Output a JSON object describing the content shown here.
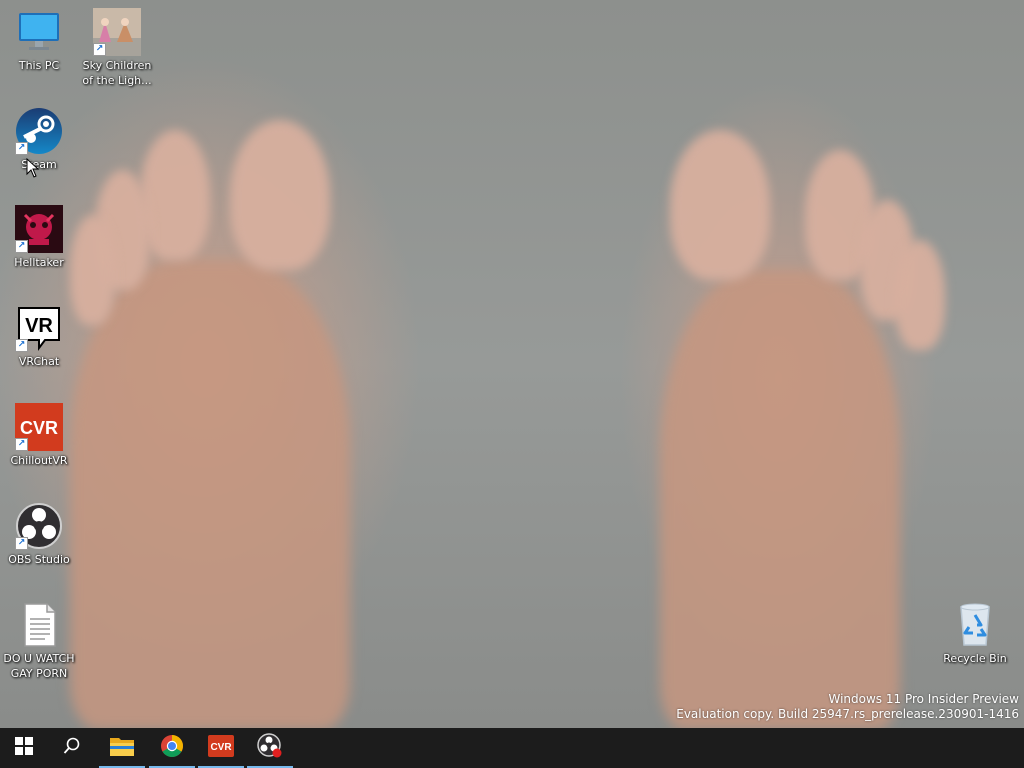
{
  "desktop": {
    "icons": [
      {
        "name": "This PC",
        "icon": "monitor-icon",
        "shortcut": false
      },
      {
        "name": "Sky Children\nof the Ligh...",
        "icon": "sky-game-icon",
        "shortcut": true
      },
      {
        "name": "Steam",
        "icon": "steam-icon",
        "shortcut": true
      },
      {
        "name": "Helltaker",
        "icon": "helltaker-icon",
        "shortcut": true
      },
      {
        "name": "VRChat",
        "icon": "vrchat-icon",
        "shortcut": true
      },
      {
        "name": "ChilloutVR",
        "icon": "chilloutvr-icon",
        "shortcut": true
      },
      {
        "name": "OBS Studio",
        "icon": "obs-icon",
        "shortcut": true
      },
      {
        "name": "DO U WATCH\nGAY PORN",
        "icon": "text-file-icon",
        "shortcut": false
      },
      {
        "name": "Recycle Bin",
        "icon": "recycle-bin-icon",
        "shortcut": false
      }
    ],
    "watermark": {
      "line1": "Windows 11 Pro Insider Preview",
      "line2": "Evaluation copy. Build 25947.rs_prerelease.230901-1416"
    }
  },
  "taskbar": {
    "items": [
      {
        "name": "Start",
        "icon": "windows-logo-icon",
        "active": false
      },
      {
        "name": "Search",
        "icon": "search-icon",
        "active": false
      },
      {
        "name": "File Explorer",
        "icon": "folder-icon",
        "active": true
      },
      {
        "name": "Google Chrome",
        "icon": "chrome-icon",
        "active": true
      },
      {
        "name": "ChilloutVR",
        "icon": "chilloutvr-icon",
        "active": true
      },
      {
        "name": "OBS Studio",
        "icon": "obs-icon",
        "active": true
      }
    ],
    "accent_color": "#76b9ed"
  },
  "icon_text": {
    "vrchat": "VR",
    "chilloutvr": "CVR"
  }
}
